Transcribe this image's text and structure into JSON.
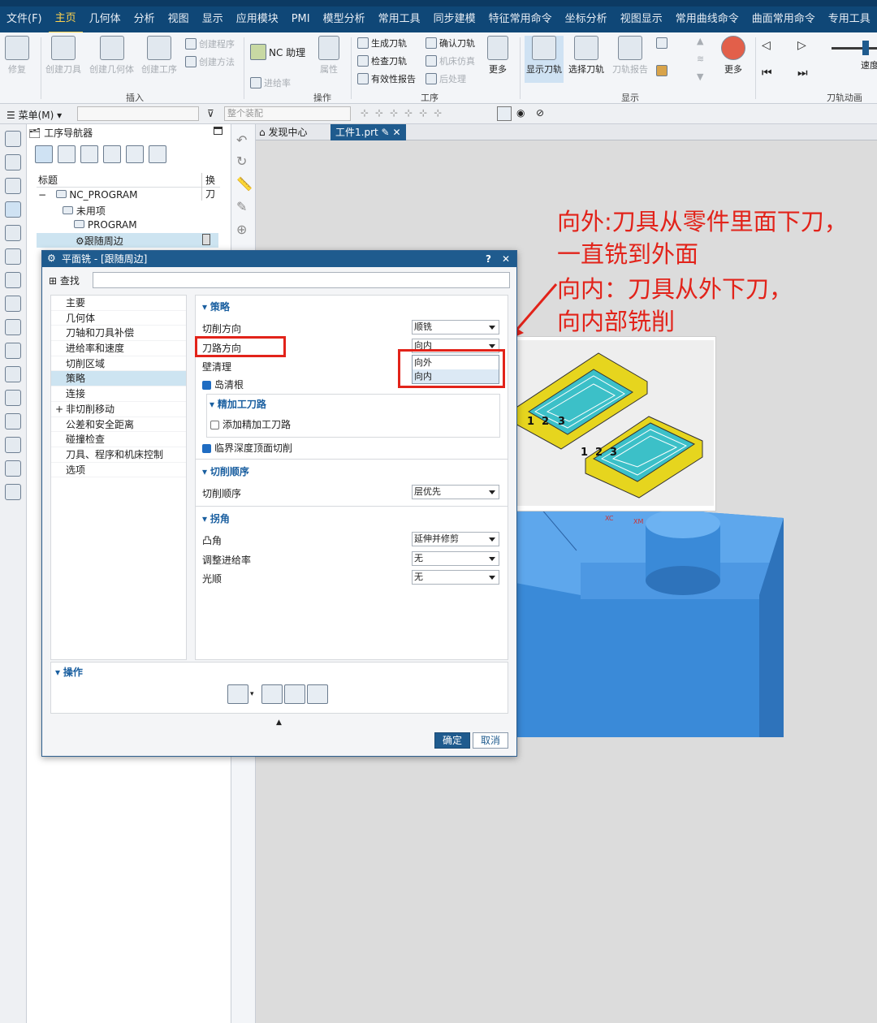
{
  "menubar": {
    "items": [
      "文件(F)",
      "主页",
      "几何体",
      "分析",
      "视图",
      "显示",
      "应用模块",
      "PMI",
      "模型分析",
      "常用工具",
      "同步建模",
      "特征常用命令",
      "坐标分析",
      "视图显示",
      "常用曲线命令",
      "曲面常用命令",
      "专用工具"
    ],
    "active_index": 1
  },
  "ribbon": {
    "b_repair": "修复",
    "b_create_tool": "创建刀具",
    "b_create_geom": "创建几何体",
    "b_create_op": "创建工序",
    "b_create_prog": "创建程序",
    "b_create_method": "创建方法",
    "b_nc_assist": "NC 助理",
    "b_feedrate": "进给率",
    "b_attr": "属性",
    "b_gen_path": "生成刀轨",
    "b_verify_path": "确认刀轨",
    "b_check_path": "检查刀轨",
    "b_machine_sim": "机床仿真",
    "b_valid_report": "有效性报告",
    "b_postprocess": "后处理",
    "b_more1": "更多",
    "b_show_path": "显示刀轨",
    "b_select_path": "选择刀轨",
    "b_path_report": "刀轨报告",
    "b_more2": "更多",
    "b_speed": "速度",
    "g_insert": "插入",
    "g_operation": "操作",
    "g_workorder": "工序",
    "g_display": "显示",
    "g_animation": "刀轨动画"
  },
  "toolbar2": {
    "menu": "菜单(M)",
    "filter_placeholder": "整个装配"
  },
  "navigator": {
    "title": "工序导航器",
    "col_title": "标题",
    "col_change": "换刀",
    "items": [
      "NC_PROGRAM",
      "未用项",
      "PROGRAM",
      "跟随周边"
    ]
  },
  "tabs": {
    "discovery": "发现中心",
    "part": "工件1.prt"
  },
  "dialog": {
    "title": "平面铣 - [跟随周边]",
    "help": "?",
    "close": "✕",
    "find_label": "查找",
    "tree": [
      "主要",
      "几何体",
      "刀轴和刀具补偿",
      "进给率和速度",
      "切削区域",
      "策略",
      "连接",
      "非切削移动",
      "公差和安全距离",
      "碰撞检查",
      "刀具、程序和机床控制",
      "选项"
    ],
    "tree_selected": 5,
    "strategy": {
      "header": "策略",
      "cut_dir_label": "切削方向",
      "cut_dir_value": "顺铣",
      "path_dir_label": "刀路方向",
      "path_dir_value": "向内",
      "dropdown_options": [
        "向外",
        "向内"
      ],
      "wall_clean_label": "壁清理",
      "island_clean_label": "岛清根",
      "finish_header": "精加工刀路",
      "add_finish_label": "添加精加工刀路",
      "crit_depth_label": "临界深度顶面切削"
    },
    "order": {
      "header": "切削顺序",
      "label": "切削顺序",
      "value": "层优先"
    },
    "corner": {
      "header": "拐角",
      "convex_label": "凸角",
      "convex_value": "延伸并修剪",
      "adjust_feed_label": "调整进给率",
      "adjust_feed_value": "无",
      "smooth_label": "光顺",
      "smooth_value": "无"
    },
    "operation_header": "操作",
    "ok": "确定",
    "cancel": "取消"
  },
  "annotation": {
    "line1": "向外:刀具从零件里面下刀，",
    "line2": "一直铣到外面",
    "line3": "向内：刀具从外下刀，",
    "line4": "向内部铣削",
    "color": "#e2231a"
  },
  "inset": {
    "labels_a": [
      "1",
      "2",
      "3"
    ],
    "labels_b": [
      "1",
      "2",
      "3"
    ]
  },
  "viewport": {
    "axis_xc": "XC",
    "axis_xm": "XM",
    "model_color": "#3f8fe0"
  }
}
